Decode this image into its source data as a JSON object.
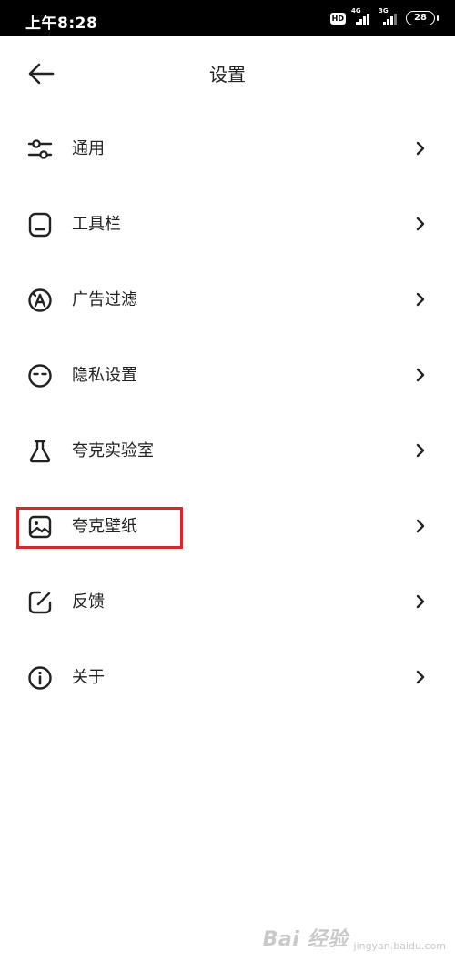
{
  "status_bar": {
    "time": "上午8:28",
    "hd": "HD",
    "signal1_gen": "4G",
    "signal2_gen": "3G",
    "battery": "28"
  },
  "header": {
    "back_icon": "arrow-left-icon",
    "title": "设置"
  },
  "settings": {
    "items": [
      {
        "label": "通用",
        "icon": "sliders-icon"
      },
      {
        "label": "工具栏",
        "icon": "toolbar-icon"
      },
      {
        "label": "广告过滤",
        "icon": "ad-block-icon"
      },
      {
        "label": "隐私设置",
        "icon": "privacy-mask-icon"
      },
      {
        "label": "夸克实验室",
        "icon": "flask-icon"
      },
      {
        "label": "夸克壁纸",
        "icon": "wallpaper-image-icon",
        "highlighted": true
      },
      {
        "label": "反馈",
        "icon": "feedback-edit-icon"
      },
      {
        "label": "关于",
        "icon": "info-icon"
      }
    ]
  },
  "annotation": {
    "highlight_color": "#d12a2a"
  },
  "watermark": {
    "main": "Bai 经验",
    "sub": "jingyan.baidu.com"
  }
}
